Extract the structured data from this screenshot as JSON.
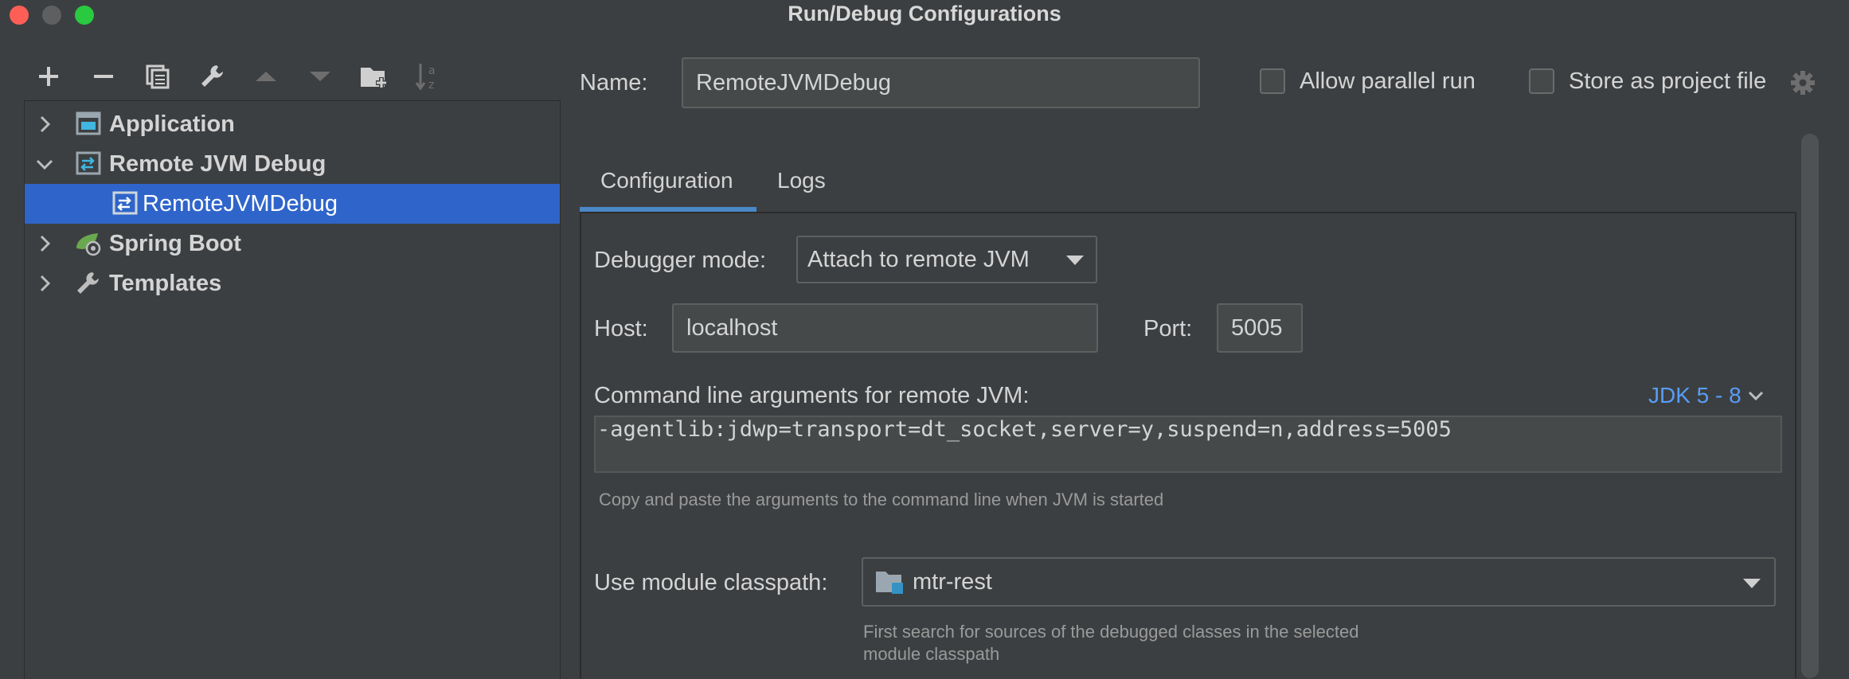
{
  "window": {
    "title": "Run/Debug Configurations"
  },
  "toolbar": {
    "buttons": [
      "add-icon",
      "remove-icon",
      "copy-icon",
      "edit-templates-icon",
      "move-up-icon",
      "move-down-icon",
      "new-folder-icon",
      "sort-icon"
    ]
  },
  "tree": {
    "items": [
      {
        "label": "Application",
        "expanded": false
      },
      {
        "label": "Remote JVM Debug",
        "expanded": true
      },
      {
        "label": "RemoteJVMDebug",
        "selected": true
      },
      {
        "label": "Spring Boot",
        "expanded": false
      },
      {
        "label": "Templates",
        "expanded": false
      }
    ]
  },
  "header": {
    "name_label": "Name:",
    "name_value": "RemoteJVMDebug",
    "allow_parallel_label": "Allow parallel run",
    "allow_parallel_checked": false,
    "store_project_label": "Store as project file",
    "store_project_checked": false
  },
  "tabs": [
    {
      "label": "Configuration",
      "active": true
    },
    {
      "label": "Logs",
      "active": false
    }
  ],
  "config": {
    "debugger_mode_label": "Debugger mode:",
    "debugger_mode_value": "Attach to remote JVM",
    "host_label": "Host:",
    "host_value": "localhost",
    "port_label": "Port:",
    "port_value": "5005",
    "cmd_label": "Command line arguments for remote JVM:",
    "jdk_link": "JDK 5 - 8",
    "cmd_value": "-agentlib:jdwp=transport=dt_socket,server=y,suspend=n,address=5005",
    "cmd_hint": "Copy and paste the arguments to the command line when JVM is started",
    "module_label": "Use module classpath:",
    "module_value": "mtr-rest",
    "module_hint_line1": "First search for sources of the debugged classes in the selected",
    "module_hint_line2": "module classpath"
  },
  "colors": {
    "background": "#3c3f41",
    "selection": "#2f65ca",
    "accent": "#4a88c7",
    "link": "#589df6"
  }
}
